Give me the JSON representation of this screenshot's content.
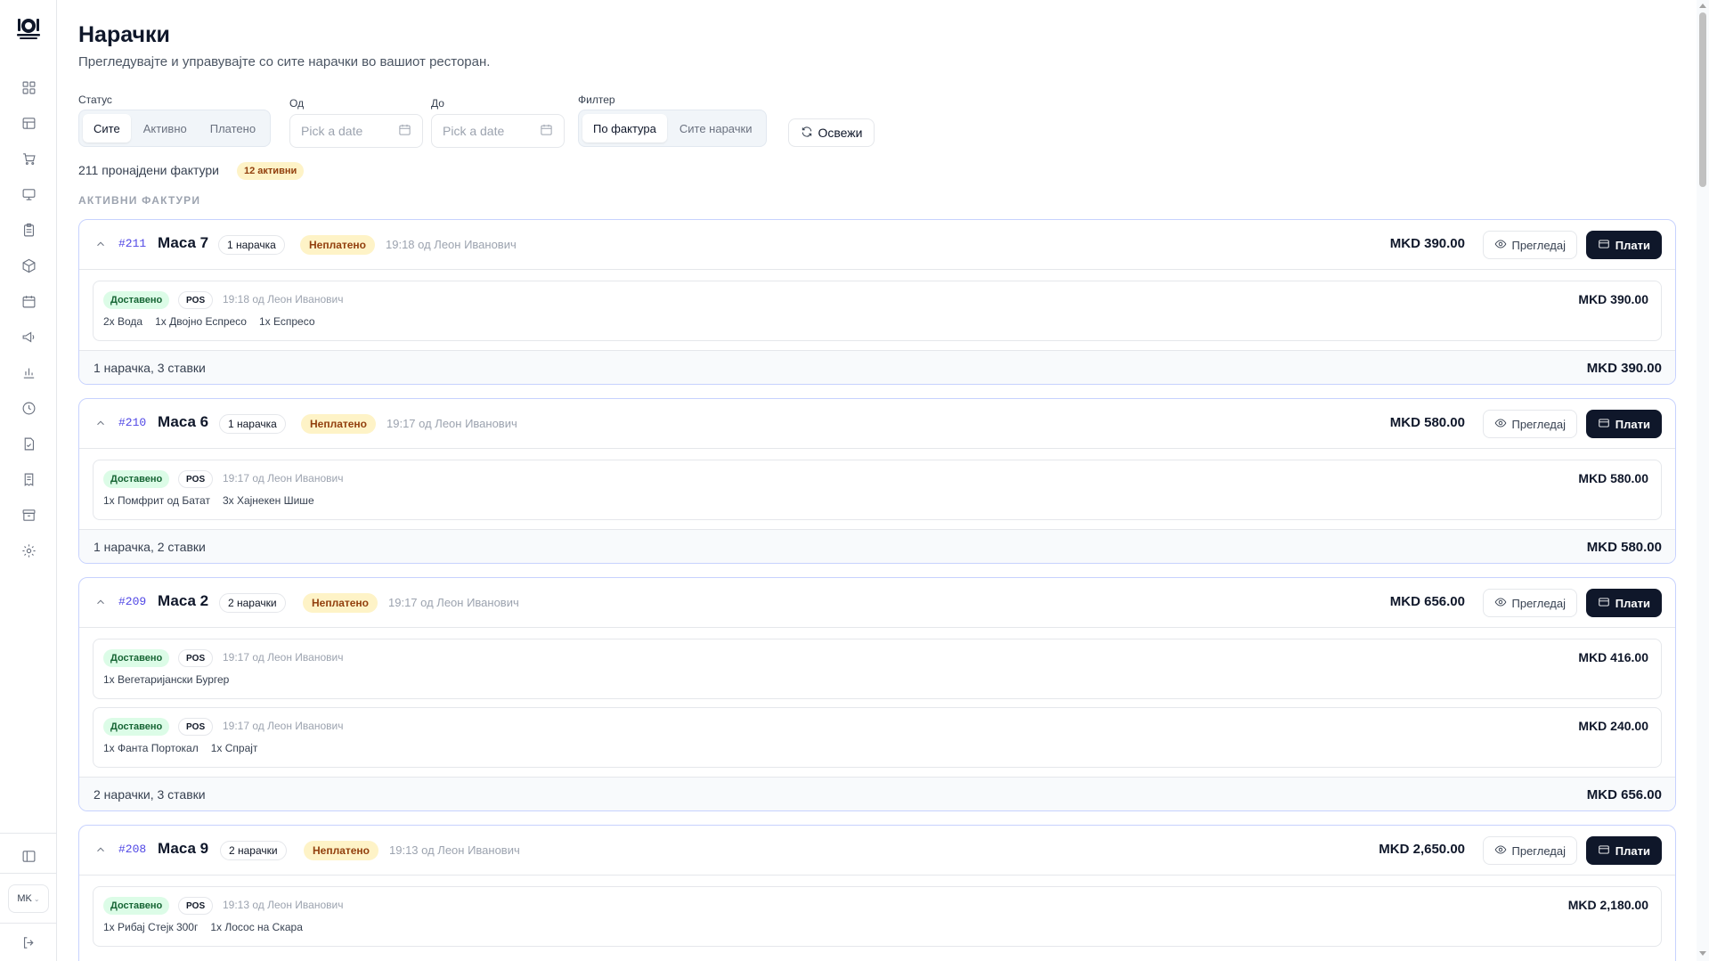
{
  "sidebar": {
    "language": "MK",
    "icons": [
      "dashboard-icon",
      "table-icon",
      "cart-icon",
      "monitor-icon",
      "clipboard-icon",
      "package-icon",
      "calendar-icon",
      "megaphone-icon",
      "bar-chart-icon",
      "clock-icon",
      "document-icon",
      "receipt-icon",
      "archive-icon",
      "settings-icon"
    ]
  },
  "page": {
    "title": "Нарачки",
    "subtitle": "Прегледувајте и управувајте со сите нарачки во вашиот ресторан."
  },
  "filters": {
    "status_label": "Статус",
    "status_options": [
      "Сите",
      "Активно",
      "Платено"
    ],
    "status_selected": "Сите",
    "from_label": "Од",
    "to_label": "До",
    "date_placeholder": "Pick a date",
    "filter_label": "Филтер",
    "filter_options": [
      "По фактура",
      "Сите нарачки"
    ],
    "filter_selected": "По фактура",
    "refresh_label": "Освежи"
  },
  "summary": {
    "found_text": "211 пронајдени фактури",
    "active_badge": "12 активни",
    "section_heading": "АКТИВНИ ФАКТУРИ"
  },
  "actions": {
    "view_label": "Прегледај",
    "pay_label": "Плати"
  },
  "invoices": [
    {
      "id": "#211",
      "table": "Маса 7",
      "orders_badge": "1 нарачка",
      "status": "Неплатено",
      "meta": "19:18  од Леон Иванович",
      "total": "MKD 390.00",
      "orders": [
        {
          "status": "Доставено",
          "source": "POS",
          "meta": "19:18  од Леон Иванович",
          "items": [
            "2x Вода",
            "1x Двојно Еспресо",
            "1x Еспресо"
          ],
          "total": "MKD 390.00"
        }
      ],
      "footer_summary": "1 нарачка, 3 ставки",
      "footer_total": "MKD 390.00"
    },
    {
      "id": "#210",
      "table": "Маса 6",
      "orders_badge": "1 нарачка",
      "status": "Неплатено",
      "meta": "19:17  од Леон Иванович",
      "total": "MKD 580.00",
      "orders": [
        {
          "status": "Доставено",
          "source": "POS",
          "meta": "19:17  од Леон Иванович",
          "items": [
            "1x Помфрит од Батат",
            "3x Хајнекен Шише"
          ],
          "total": "MKD 580.00"
        }
      ],
      "footer_summary": "1 нарачка, 2 ставки",
      "footer_total": "MKD 580.00"
    },
    {
      "id": "#209",
      "table": "Маса 2",
      "orders_badge": "2 нарачки",
      "status": "Неплатено",
      "meta": "19:17  од Леон Иванович",
      "total": "MKD 656.00",
      "orders": [
        {
          "status": "Доставено",
          "source": "POS",
          "meta": "19:17  од Леон Иванович",
          "items": [
            "1x Вегетаријански Бургер"
          ],
          "total": "MKD 416.00"
        },
        {
          "status": "Доставено",
          "source": "POS",
          "meta": "19:17  од Леон Иванович",
          "items": [
            "1x Фанта Портокал",
            "1x Спрајт"
          ],
          "total": "MKD 240.00"
        }
      ],
      "footer_summary": "2 нарачки, 3 ставки",
      "footer_total": "MKD 656.00"
    },
    {
      "id": "#208",
      "table": "Маса 9",
      "orders_badge": "2 нарачки",
      "status": "Неплатено",
      "meta": "19:13  од Леон Иванович",
      "total": "MKD 2,650.00",
      "orders": [
        {
          "status": "Доставено",
          "source": "POS",
          "meta": "19:13  од Леон Иванович",
          "items": [
            "1x Рибај Стејк 300г",
            "1x Лосос на Скара"
          ],
          "total": "MKD 2,180.00"
        }
      ],
      "footer_summary": "",
      "footer_total": ""
    }
  ]
}
